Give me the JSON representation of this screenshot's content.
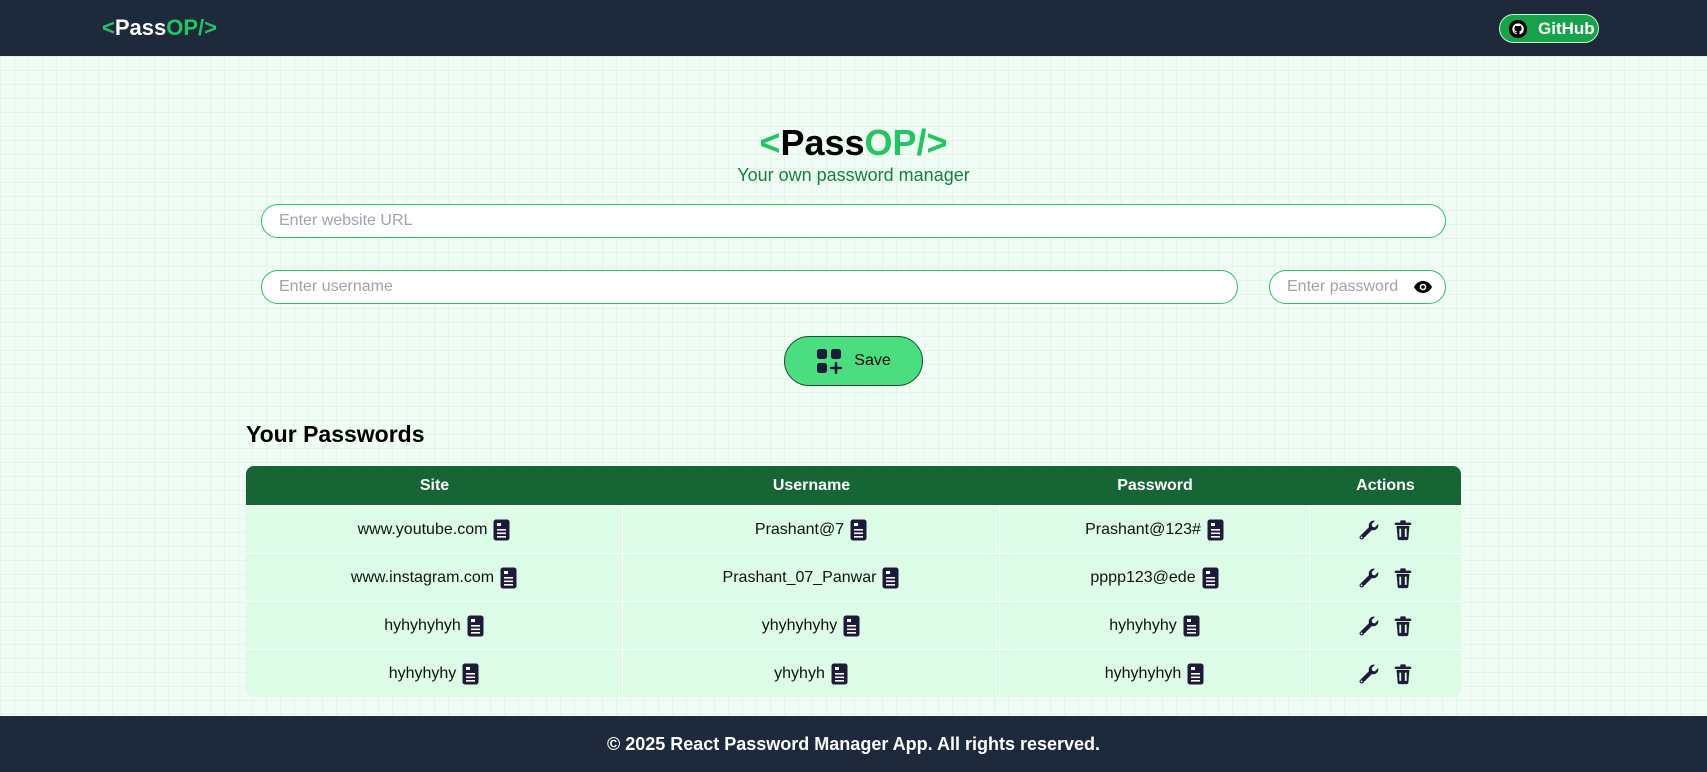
{
  "nav": {
    "logo": {
      "open": "<",
      "pass": "Pass",
      "op": "OP/>"
    },
    "github_label": "GitHub"
  },
  "hero": {
    "logo": {
      "open": "<",
      "pass": "Pass",
      "op": "OP/>"
    },
    "tagline": "Your own password manager"
  },
  "form": {
    "url_placeholder": "Enter website URL",
    "username_placeholder": "Enter username",
    "password_placeholder": "Enter password",
    "save_label": "Save"
  },
  "passwords": {
    "title": "Your Passwords",
    "headers": [
      "Site",
      "Username",
      "Password",
      "Actions"
    ],
    "rows": [
      {
        "site": "www.youtube.com",
        "username": "Prashant@7",
        "password": "Prashant@123#"
      },
      {
        "site": "www.instagram.com",
        "username": "Prashant_07_Panwar",
        "password": "pppp123@ede"
      },
      {
        "site": "hyhyhyhyh",
        "username": "yhyhyhyhy",
        "password": "hyhyhyhy"
      },
      {
        "site": "hyhyhyhy",
        "username": "yhyhyh",
        "password": "hyhyhyhyh"
      }
    ]
  },
  "footer": {
    "text": "© 2025 React Password Manager App. All rights reserved."
  },
  "colors": {
    "nav_bg": "#1e293b",
    "accent_green": "#22c55e",
    "header_green": "#166534",
    "row_bg": "#dcfce7",
    "save_bg": "#4ade80",
    "icon_dark": "#1e1b3a"
  },
  "icons": {
    "github": "github-icon",
    "eye": "eye-icon",
    "save": "add-grid-icon",
    "copy": "copy-icon",
    "edit": "wrench-icon",
    "delete": "trash-icon"
  }
}
